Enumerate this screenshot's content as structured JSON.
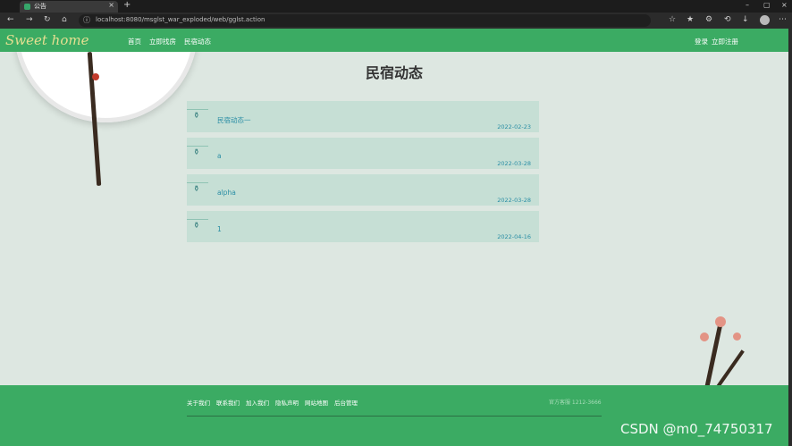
{
  "browser": {
    "tab_title": "公告",
    "url": "localhost:8080/msglst_war_exploded/web/gglst.action",
    "tab_close": "×",
    "tab_new": "+",
    "win_minimize": "–",
    "win_maximize": "▢",
    "win_close": "×"
  },
  "header": {
    "logo": "Sweet home",
    "nav": [
      "首页",
      "立即找房",
      "民宿动态"
    ],
    "login": "登录",
    "register": "立即注册"
  },
  "main": {
    "title": "民宿动态",
    "items": [
      {
        "title": "民宿动态一",
        "date": "2022-02-23"
      },
      {
        "title": "a",
        "date": "2022-03-28"
      },
      {
        "title": "alpha",
        "date": "2022-03-28"
      },
      {
        "title": "1",
        "date": "2022-04-16"
      }
    ]
  },
  "footer": {
    "links": [
      "关于我们",
      "联系我们",
      "加入我们",
      "隐私声明",
      "网站地图",
      "后台管理"
    ],
    "phone": "官方客服 1212-3666"
  },
  "watermark": "CSDN @m0_74750317"
}
